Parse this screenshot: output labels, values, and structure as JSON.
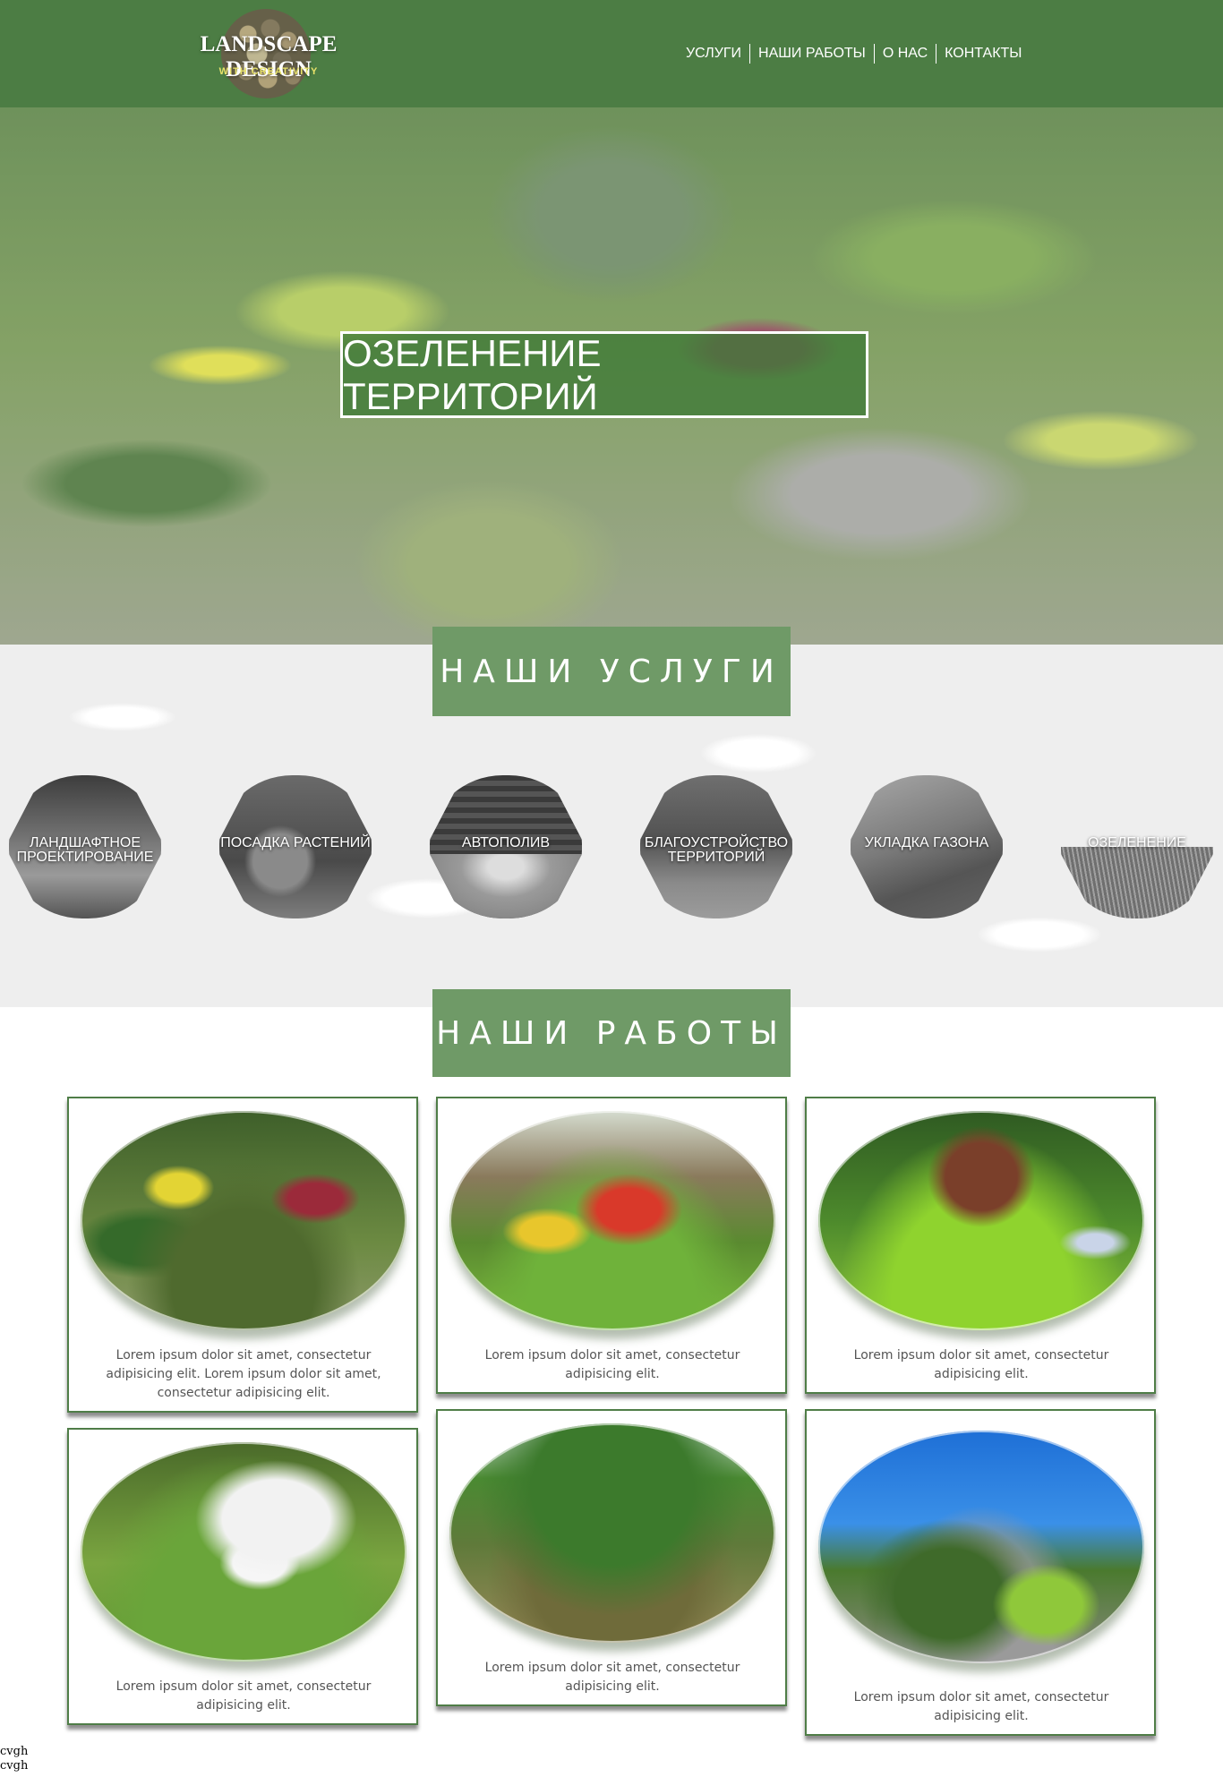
{
  "brand": {
    "title": "LANDSCAPE DESIGN",
    "subtitle": "WITH CREATIVITY"
  },
  "nav": {
    "items": [
      "УСЛУГИ",
      "НАШИ РАБОТЫ",
      "О НАС",
      "КОНТАКТЫ"
    ]
  },
  "hero": {
    "title": "ОЗЕЛЕНЕНИЕ ТЕРРИТОРИЙ"
  },
  "services": {
    "heading": "НАШИ УСЛУГИ",
    "items": [
      {
        "label": "ЛАНДШАФТНОЕ ПРОЕКТИРОВАНИЕ"
      },
      {
        "label": "ПОСАДКА РАСТЕНИЙ"
      },
      {
        "label": "АВТОПОЛИВ"
      },
      {
        "label": "БЛАГОУСТРОЙСТВО ТЕРРИТОРИЙ"
      },
      {
        "label": "УКЛАДКА ГАЗОНА"
      },
      {
        "label": "ОЗЕЛЕНЕНИЕ"
      }
    ]
  },
  "works": {
    "heading": "НАШИ РАБОТЫ",
    "items": [
      {
        "text": "Lorem ipsum dolor sit amet, consectetur adipisicing elit. Lorem ipsum dolor sit amet, consectetur adipisicing elit."
      },
      {
        "text": "Lorem ipsum dolor sit amet, consectetur adipisicing elit."
      },
      {
        "text": "Lorem ipsum dolor sit amet, consectetur adipisicing elit."
      },
      {
        "text": "Lorem ipsum dolor sit amet, consectetur adipisicing elit."
      },
      {
        "text": "Lorem ipsum dolor sit amet, consectetur adipisicing elit."
      },
      {
        "text": "Lorem ipsum dolor sit amet, consectetur adipisicing elit."
      }
    ]
  },
  "footer": {
    "lines": [
      "cvgh",
      "cvgh"
    ]
  },
  "colors": {
    "header_green": "#4c7d44",
    "label_green": "#6f9a67",
    "card_border": "#4f7d47"
  }
}
